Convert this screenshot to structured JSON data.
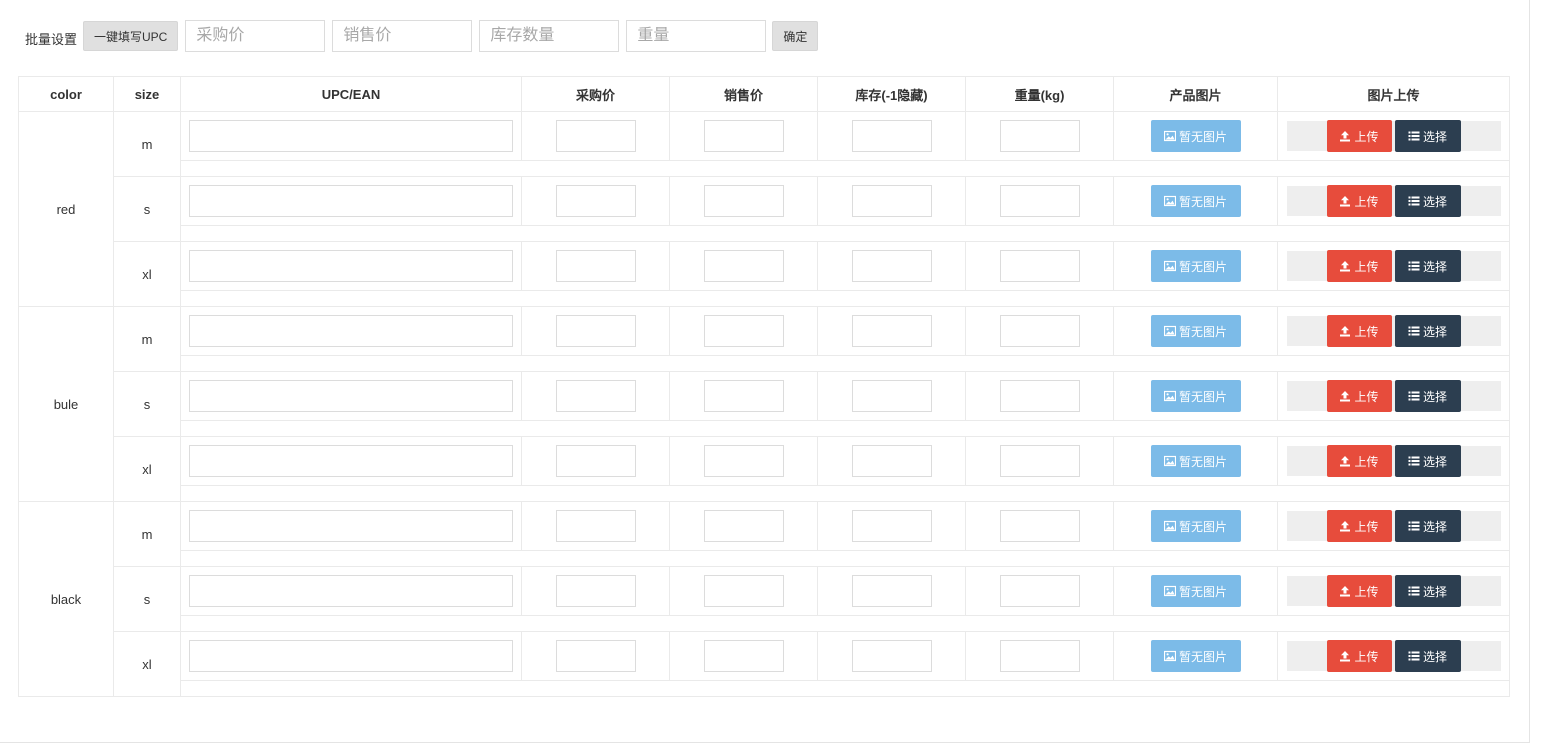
{
  "batch": {
    "label": "批量设置",
    "fill_upc_button": "一键填写UPC",
    "purchase_price_placeholder": "采购价",
    "sale_price_placeholder": "销售价",
    "stock_placeholder": "库存数量",
    "weight_placeholder": "重量",
    "confirm_button": "确定"
  },
  "table": {
    "headers": {
      "color": "color",
      "size": "size",
      "upc": "UPC/EAN",
      "purchase_price": "采购价",
      "sale_price": "销售价",
      "stock": "库存(-1隐藏)",
      "weight": "重量(kg)",
      "product_image": "产品图片",
      "image_upload": "图片上传"
    },
    "groups": [
      {
        "color": "red",
        "sizes": [
          "m",
          "s",
          "xl"
        ]
      },
      {
        "color": "bule",
        "sizes": [
          "m",
          "s",
          "xl"
        ]
      },
      {
        "color": "black",
        "sizes": [
          "m",
          "s",
          "xl"
        ]
      }
    ],
    "no_image_label": "暂无图片",
    "upload_label": "上传",
    "select_label": "选择"
  },
  "icons": {
    "image": "image-icon",
    "upload": "upload-icon",
    "list": "list-icon"
  },
  "colors": {
    "no_image_button": "#7cbbe8",
    "upload_button": "#e74c3c",
    "select_button": "#2c3e50"
  }
}
